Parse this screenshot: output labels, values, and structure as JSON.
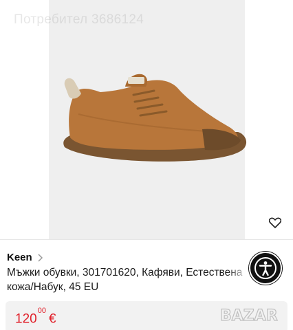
{
  "watermark": "Потребител 3686124",
  "product": {
    "brand": "Keen",
    "title": "Мъжки обувки, 301701620, Кафяви, Естествена кожа/Набук, 45 EU",
    "price_whole": "120",
    "price_cents": "00",
    "currency": "€",
    "shoe_color": "#b8763a"
  },
  "logo": {
    "text": "BAZAR"
  },
  "icons": {
    "favorite": "heart-outline-icon",
    "brand_chevron": "chevron-right-icon",
    "accessibility": "accessibility-icon"
  },
  "colors": {
    "price": "#e0202a",
    "accessibility_bg": "#111111"
  }
}
